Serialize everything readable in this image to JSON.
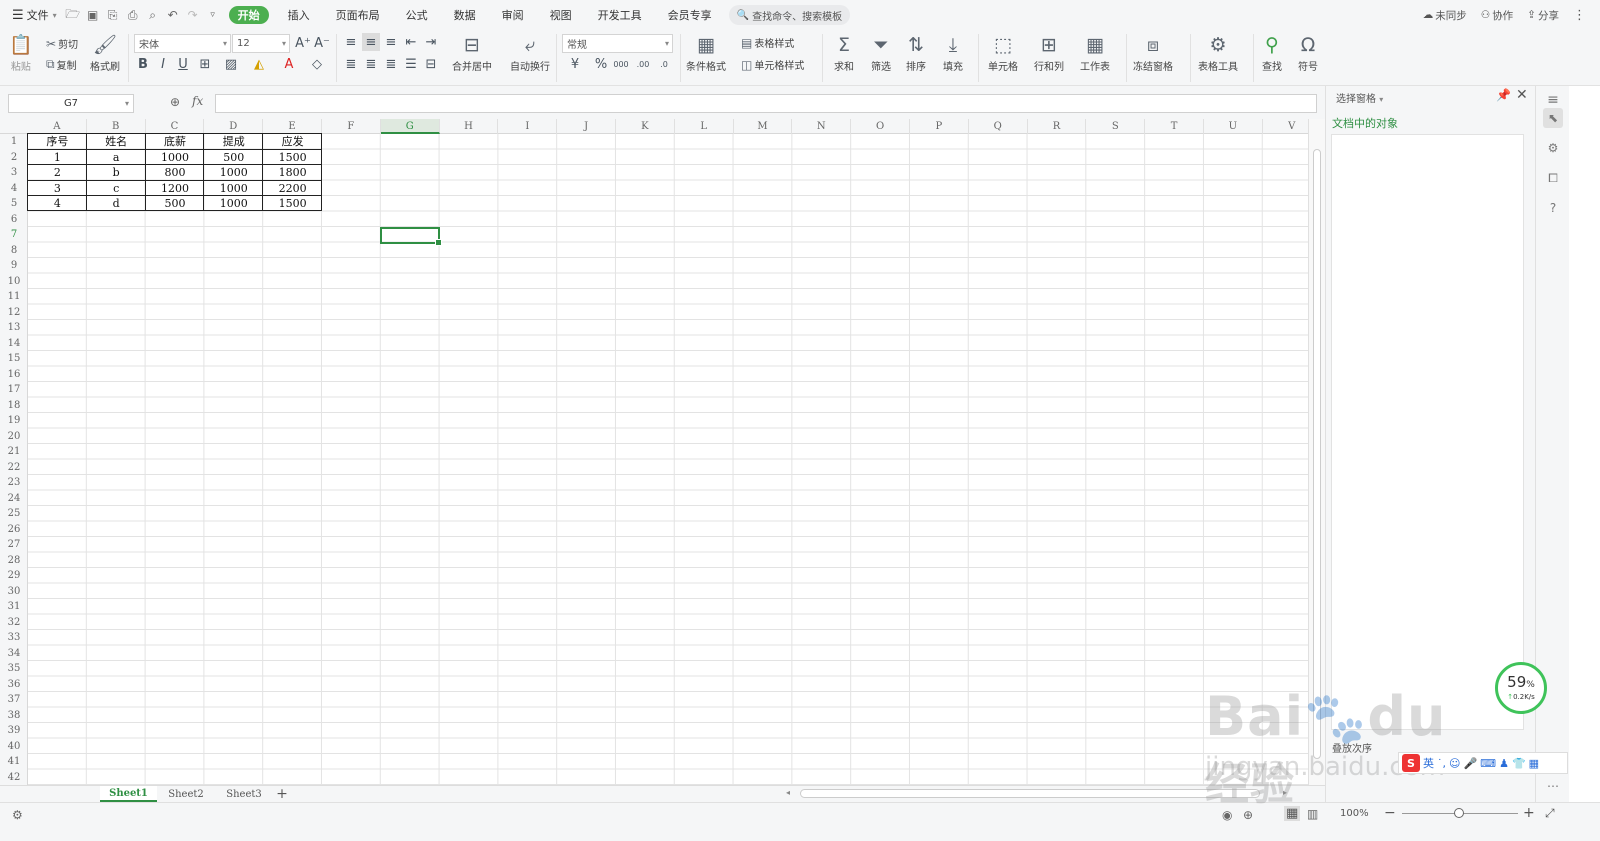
{
  "menubar": {
    "file": "文件",
    "tabs": [
      "开始",
      "插入",
      "页面布局",
      "公式",
      "数据",
      "审阅",
      "视图",
      "开发工具",
      "会员专享"
    ],
    "active_tab": "开始",
    "search_placeholder": "查找命令、搜索模板",
    "right": {
      "sync": "未同步",
      "collab": "协作",
      "share": "分享"
    }
  },
  "ribbon": {
    "paste": "粘贴",
    "cut": "剪切",
    "copy": "复制",
    "format_painter": "格式刷",
    "font": "宋体",
    "font_size": "12",
    "merge": "合并居中",
    "wrap": "自动换行",
    "number_format": "常规",
    "cond_format": "条件格式",
    "table_style": "表格样式",
    "cell_style": "单元格样式",
    "sum": "求和",
    "filter": "筛选",
    "sort": "排序",
    "fill": "填充",
    "cells": "单元格",
    "rowcol": "行和列",
    "sheet": "工作表",
    "freeze": "冻结窗格",
    "table_tools": "表格工具",
    "find": "查找",
    "symbol": "符号"
  },
  "formula": {
    "name_box": "G7",
    "fx": "fx",
    "content": ""
  },
  "sheet": {
    "columns": [
      "A",
      "B",
      "C",
      "D",
      "E",
      "F",
      "G",
      "H",
      "I",
      "J",
      "K",
      "L",
      "M",
      "N",
      "O",
      "P",
      "Q",
      "R",
      "S",
      "T",
      "U",
      "V"
    ],
    "selected_column": "G",
    "selected_row": "7",
    "row_count": 42,
    "rows": [
      [
        "序号",
        "姓名",
        "底薪",
        "提成",
        "应发"
      ],
      [
        "1",
        "a",
        "1000",
        "500",
        "1500"
      ],
      [
        "2",
        "b",
        "800",
        "1000",
        "1800"
      ],
      [
        "3",
        "c",
        "1200",
        "1000",
        "2200"
      ],
      [
        "4",
        "d",
        "500",
        "1000",
        "1500"
      ]
    ]
  },
  "sheet_tabs": {
    "tabs": [
      "Sheet1",
      "Sheet2",
      "Sheet3"
    ],
    "active": "Sheet1",
    "add": "+"
  },
  "status": {
    "zoom": "100%"
  },
  "pane": {
    "title": "选择窗格",
    "subtitle": "文档中的对象",
    "order": "叠放次序"
  },
  "gauge": {
    "percent": "59",
    "unit": "%",
    "speed": "0.2K/s"
  },
  "watermark": {
    "brand": "Bai",
    "brand2": "du",
    "cn": "经验",
    "url": "jingyan.baidu.com"
  },
  "ime": {
    "lang": "英"
  },
  "colors": {
    "accent": "#2f8f43",
    "active_tab_bg": "#4caf50"
  }
}
